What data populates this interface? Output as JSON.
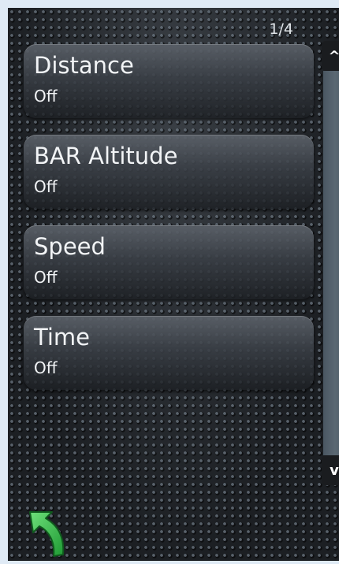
{
  "header": {
    "page_indicator": "1/4"
  },
  "list": {
    "items": [
      {
        "title": "Distance",
        "value": "Off"
      },
      {
        "title": "BAR Altitude",
        "value": "Off"
      },
      {
        "title": "Speed",
        "value": "Off"
      },
      {
        "title": "Time",
        "value": "Off"
      }
    ]
  },
  "scrollbar": {
    "up_icon": "chevron-up-icon",
    "down_icon": "chevron-down-icon",
    "up_glyph": "^",
    "down_glyph": "v"
  },
  "footer": {
    "back_icon": "back-arrow-icon"
  },
  "colors": {
    "accent_green": "#35c24a",
    "text": "#f2f4f6",
    "track": "#56636e"
  }
}
